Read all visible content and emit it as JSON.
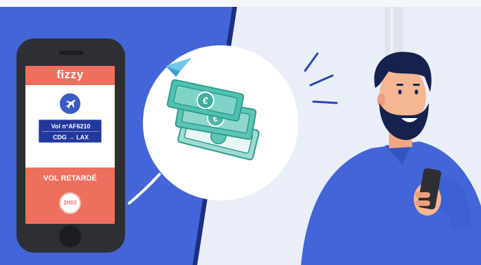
{
  "phone": {
    "app_name": "fizzy",
    "flight_number": "Vol n°AF6210",
    "flight_route": "CDG → LAX",
    "status": "VOL RETARDÉ",
    "delay": "2H03"
  },
  "icons": [
    "plane-icon",
    "euro-banknote-icon",
    "paper-plane-icon"
  ],
  "colors": {
    "blue_panel": "#4465d8",
    "coral_accent": "#ef6f5e",
    "navy_box": "#24379b",
    "banknote_teal": "#4fc1b1",
    "sky_background": "#e9eef8"
  }
}
